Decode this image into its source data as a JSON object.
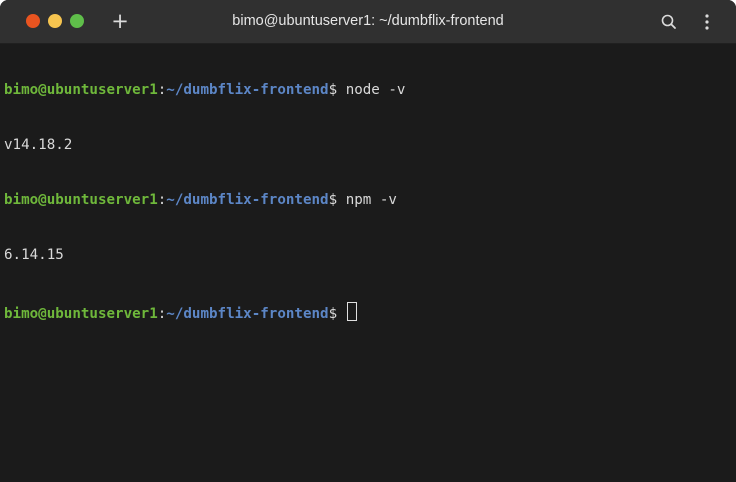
{
  "window": {
    "title": "bimo@ubuntuserver1: ~/dumbflix-frontend",
    "new_tab_label": "+"
  },
  "icons": {
    "close": "close-dot",
    "minimize": "minimize-dot",
    "maximize": "maximize-dot",
    "new_tab": "plus-icon",
    "search": "search-icon",
    "menu": "kebab-menu-icon"
  },
  "colors": {
    "close": "#e95420",
    "minimize": "#f6c44f",
    "maximize": "#5fbe4a",
    "prompt_user": "#6fb83b",
    "prompt_path": "#5c86c6",
    "background": "#1b1b1b"
  },
  "terminal": {
    "lines": [
      {
        "user": "bimo@ubuntuserver1",
        "sep": ":",
        "path": "~/dumbflix-frontend",
        "dollar": "$ ",
        "command": "node -v"
      },
      {
        "output": "v14.18.2"
      },
      {
        "user": "bimo@ubuntuserver1",
        "sep": ":",
        "path": "~/dumbflix-frontend",
        "dollar": "$ ",
        "command": "npm -v"
      },
      {
        "output": "6.14.15"
      },
      {
        "user": "bimo@ubuntuserver1",
        "sep": ":",
        "path": "~/dumbflix-frontend",
        "dollar": "$ ",
        "command": ""
      }
    ]
  }
}
